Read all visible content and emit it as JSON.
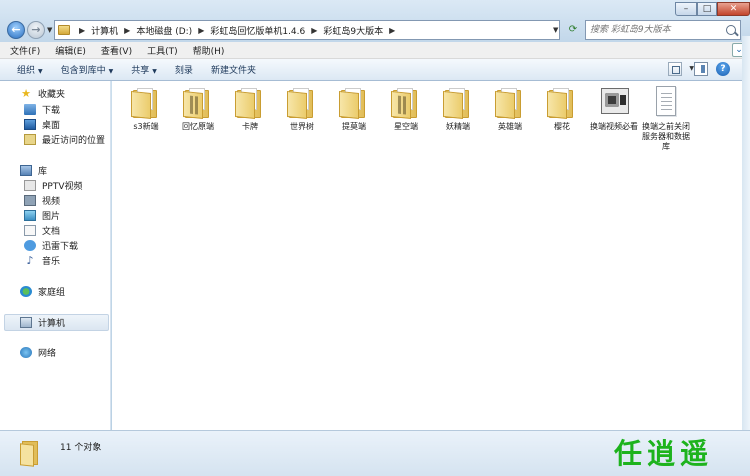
{
  "window": {
    "controls": {
      "minimize": "–",
      "maximize": "□",
      "close": "✕"
    }
  },
  "address": {
    "crumbs": [
      "计算机",
      "本地磁盘 (D:)",
      "彩虹岛回忆版单机1.4.6",
      "彩虹岛9大版本"
    ]
  },
  "search": {
    "placeholder": "搜索 彩虹岛9大版本"
  },
  "menubar": {
    "items": [
      "文件(F)",
      "编辑(E)",
      "查看(V)",
      "工具(T)",
      "帮助(H)"
    ]
  },
  "commandbar": {
    "organize": "组织",
    "include_in_library": "包含到库中",
    "share": "共享",
    "burn": "刻录",
    "new_folder": "新建文件夹"
  },
  "navpane": {
    "favorites": "收藏夹",
    "downloads": "下载",
    "desktop": "桌面",
    "recent": "最近访问的位置",
    "libraries": "库",
    "pptv": "PPTV视频",
    "videos": "视频",
    "pictures": "图片",
    "documents": "文档",
    "thunder": "迅雷下载",
    "music": "音乐",
    "homegroup": "家庭组",
    "computer": "计算机",
    "network": "网络"
  },
  "files": [
    {
      "name": "s3新端",
      "type": "folder"
    },
    {
      "name": "回忆原端",
      "type": "folder-dark"
    },
    {
      "name": "卡牌",
      "type": "folder"
    },
    {
      "name": "世界树",
      "type": "folder"
    },
    {
      "name": "提莫端",
      "type": "folder"
    },
    {
      "name": "星空端",
      "type": "folder-dark"
    },
    {
      "name": "妖精端",
      "type": "folder"
    },
    {
      "name": "英雄端",
      "type": "folder"
    },
    {
      "name": "樱花",
      "type": "folder"
    },
    {
      "name": "换端视频必看",
      "type": "video"
    },
    {
      "name": "换端之前关闭服务器和数据库",
      "type": "text"
    }
  ],
  "status": {
    "count": "11 个对象"
  },
  "watermark": "任逍遥"
}
